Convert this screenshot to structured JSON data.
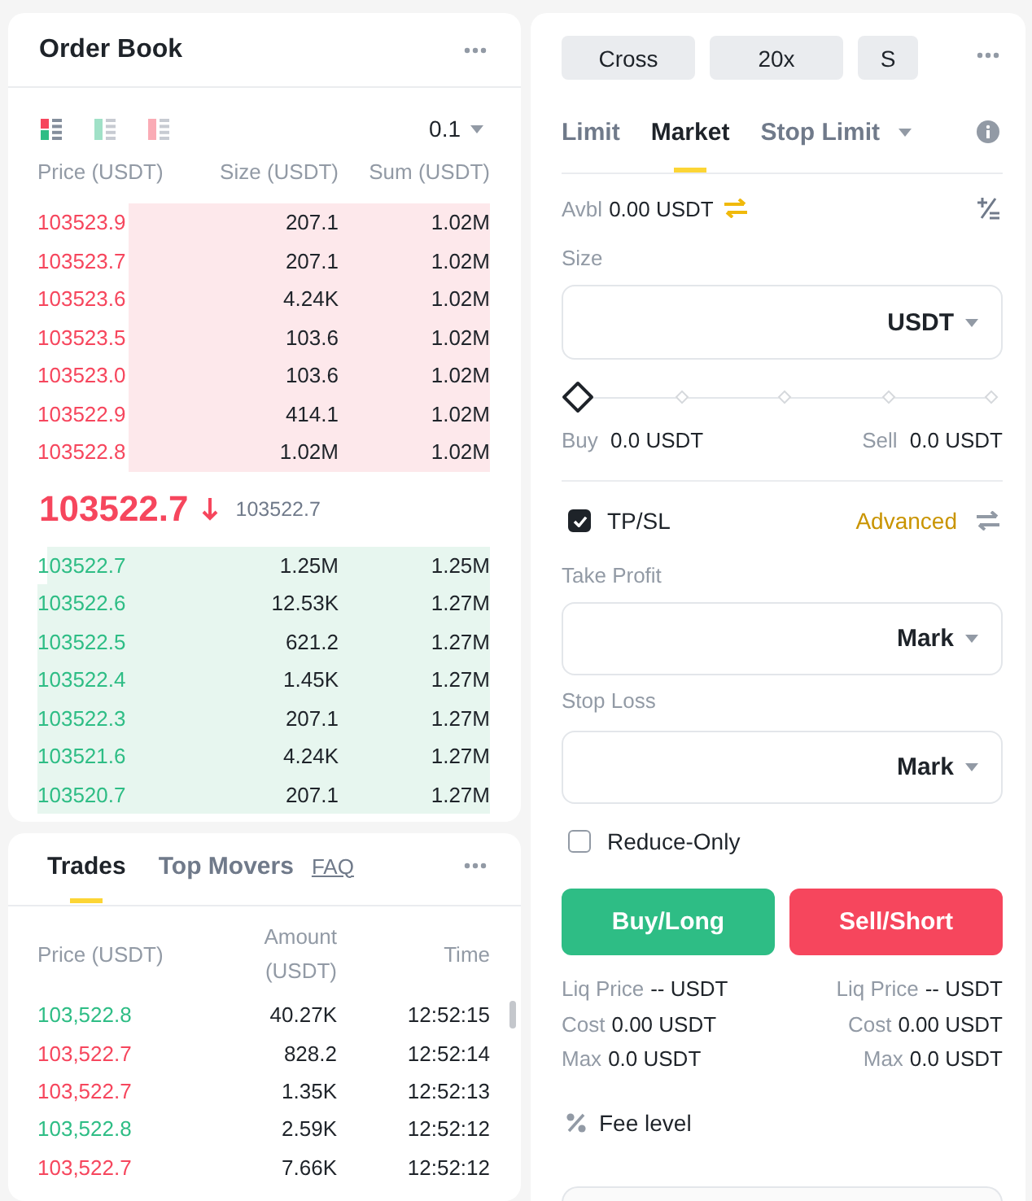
{
  "order_book": {
    "title": "Order Book",
    "view_modes": [
      {
        "kind": "both",
        "selected": true
      },
      {
        "kind": "bids",
        "selected": false
      },
      {
        "kind": "asks",
        "selected": false
      }
    ],
    "tick_size": "0.1",
    "columns": [
      "Price (USDT)",
      "Size (USDT)",
      "Sum (USDT)"
    ],
    "asks": [
      {
        "price": "103523.9",
        "size": "207.1",
        "sum": "1.02M",
        "level": 0.8
      },
      {
        "price": "103523.7",
        "size": "207.1",
        "sum": "1.02M",
        "level": 0.8
      },
      {
        "price": "103523.6",
        "size": "4.24K",
        "sum": "1.02M",
        "level": 0.8
      },
      {
        "price": "103523.5",
        "size": "103.6",
        "sum": "1.02M",
        "level": 0.8
      },
      {
        "price": "103523.0",
        "size": "103.6",
        "sum": "1.02M",
        "level": 0.8
      },
      {
        "price": "103522.9",
        "size": "414.1",
        "sum": "1.02M",
        "level": 0.8
      },
      {
        "price": "103522.8",
        "size": "1.02M",
        "sum": "1.02M",
        "level": 0.8
      }
    ],
    "last_price": "103522.7",
    "price_falling": true,
    "mark_price": "103522.7",
    "bids": [
      {
        "price": "103522.7",
        "size": "1.25M",
        "sum": "1.25M",
        "level": 0.98
      },
      {
        "price": "103522.6",
        "size": "12.53K",
        "sum": "1.27M",
        "level": 1
      },
      {
        "price": "103522.5",
        "size": "621.2",
        "sum": "1.27M",
        "level": 1
      },
      {
        "price": "103522.4",
        "size": "1.45K",
        "sum": "1.27M",
        "level": 1
      },
      {
        "price": "103522.3",
        "size": "207.1",
        "sum": "1.27M",
        "level": 1
      },
      {
        "price": "103521.6",
        "size": "4.24K",
        "sum": "1.27M",
        "level": 1
      },
      {
        "price": "103520.7",
        "size": "207.1",
        "sum": "1.27M",
        "level": 1
      }
    ]
  },
  "trades": {
    "tabs": [
      {
        "label": "Trades",
        "selected": true
      },
      {
        "label": "Top Movers",
        "selected": false
      }
    ],
    "link": "FAQ",
    "columns": [
      "Price (USDT)",
      "Amount (USDT)",
      "Time"
    ],
    "rows": [
      {
        "price": "103,522.8",
        "color": "#2ebd85",
        "amount": "40.27K",
        "time": "12:52:15"
      },
      {
        "price": "103,522.7",
        "color": "#f6465d",
        "amount": "828.2",
        "time": "12:52:14"
      },
      {
        "price": "103,522.7",
        "color": "#f6465d",
        "amount": "1.35K",
        "time": "12:52:13"
      },
      {
        "price": "103,522.8",
        "color": "#2ebd85",
        "amount": "2.59K",
        "time": "12:52:12"
      },
      {
        "price": "103,522.7",
        "color": "#f6465d",
        "amount": "7.66K",
        "time": "12:52:12"
      }
    ]
  },
  "order_form": {
    "margin_buttons": [
      "Cross",
      "20x",
      "S"
    ],
    "order_types": [
      {
        "label": "Limit",
        "selected": false,
        "has_menu": false
      },
      {
        "label": "Market",
        "selected": true,
        "has_menu": false
      },
      {
        "label": "Stop Limit",
        "selected": false,
        "has_menu": true
      }
    ],
    "available": {
      "label": "Avbl",
      "value": "0.00 USDT"
    },
    "size": {
      "label": "Size",
      "unit": "USDT"
    },
    "slider": {
      "level": 0
    },
    "amounts": [
      {
        "label": "Buy",
        "value": "0.0 USDT"
      },
      {
        "label": "Sell",
        "value": "0.0 USDT"
      }
    ],
    "tpsl": {
      "label": "TP/SL",
      "checked": true,
      "link": "Advanced"
    },
    "take_profit": {
      "label": "Take Profit",
      "trigger": "Mark"
    },
    "stop_loss": {
      "label": "Stop Loss",
      "trigger": "Mark"
    },
    "reduce_only": {
      "label": "Reduce-Only",
      "checked": false
    },
    "actions": [
      {
        "label": "Buy/Long",
        "kind": "buy"
      },
      {
        "label": "Sell/Short",
        "kind": "sell"
      }
    ],
    "summary": [
      [
        {
          "label": "Liq Price",
          "value": "-- USDT"
        },
        {
          "label": "Cost",
          "value": "0.00 USDT"
        },
        {
          "label": "Max",
          "value": "0.0 USDT"
        }
      ],
      [
        {
          "label": "Liq Price",
          "value": "-- USDT"
        },
        {
          "label": "Cost",
          "value": "0.00 USDT"
        },
        {
          "label": "Max",
          "value": "0.0 USDT"
        }
      ]
    ],
    "fee_level": "Fee level"
  }
}
